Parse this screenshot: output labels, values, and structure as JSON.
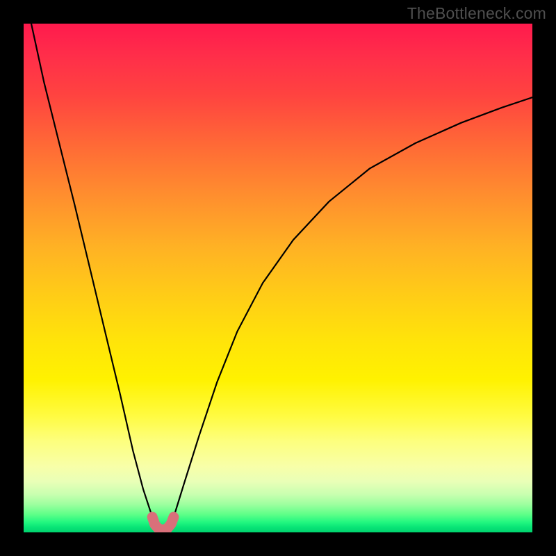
{
  "watermark": "TheBottleneck.com",
  "chart_data": {
    "type": "line",
    "title": "",
    "xlabel": "",
    "ylabel": "",
    "xlim": [
      0,
      1
    ],
    "ylim": [
      0,
      1
    ],
    "notes": "V-shaped bottleneck curve over vertical red→green gradient. Minimum near x≈0.27 where curve touches the green band. No visible axes, ticks, or labels. Values are normalized 0–1 estimates read from the image.",
    "series": [
      {
        "name": "left-branch",
        "x": [
          0.015,
          0.04,
          0.07,
          0.1,
          0.13,
          0.16,
          0.19,
          0.215,
          0.235,
          0.253
        ],
        "y": [
          1.0,
          0.885,
          0.765,
          0.645,
          0.52,
          0.395,
          0.27,
          0.16,
          0.085,
          0.03
        ]
      },
      {
        "name": "right-branch",
        "x": [
          0.295,
          0.315,
          0.345,
          0.38,
          0.42,
          0.47,
          0.53,
          0.6,
          0.68,
          0.77,
          0.86,
          0.94,
          1.0
        ],
        "y": [
          0.03,
          0.095,
          0.19,
          0.295,
          0.395,
          0.49,
          0.575,
          0.65,
          0.715,
          0.765,
          0.805,
          0.835,
          0.855
        ]
      },
      {
        "name": "valley-marker",
        "style": "thick-rounded",
        "color": "#d9707a",
        "x": [
          0.253,
          0.258,
          0.265,
          0.273,
          0.282,
          0.29,
          0.295
        ],
        "y": [
          0.03,
          0.015,
          0.007,
          0.005,
          0.007,
          0.017,
          0.03
        ]
      }
    ]
  }
}
